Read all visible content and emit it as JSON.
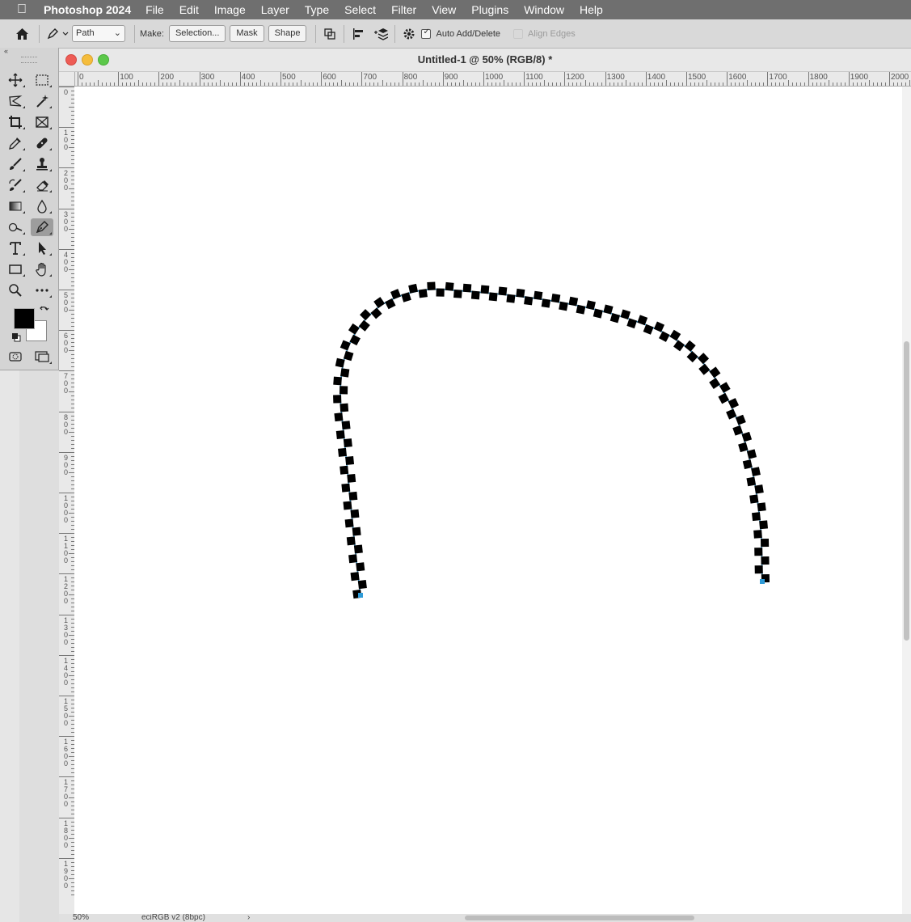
{
  "menubar": {
    "app_name": "Photoshop 2024",
    "items": [
      "File",
      "Edit",
      "Image",
      "Layer",
      "Type",
      "Select",
      "Filter",
      "View",
      "Plugins",
      "Window",
      "Help"
    ]
  },
  "options_bar": {
    "mode_value": "Path",
    "make_label": "Make:",
    "selection_button": "Selection...",
    "mask_button": "Mask",
    "shape_button": "Shape",
    "auto_add_delete_label": "Auto Add/Delete",
    "auto_add_delete_checked": true,
    "align_edges_label": "Align Edges",
    "align_edges_enabled": false
  },
  "document": {
    "title": "Untitled-1 @ 50% (RGB/8) *",
    "zoom": "50%",
    "color_profile": "eciRGB v2 (8bpc)"
  },
  "rulers": {
    "horizontal_labels": [
      "0",
      "100",
      "200",
      "300",
      "400",
      "500",
      "600",
      "700",
      "800",
      "900",
      "1000",
      "1100",
      "1200",
      "1300",
      "1400",
      "1500",
      "1600",
      "1700",
      "1800",
      "1900",
      "2000"
    ],
    "vertical_labels": [
      "0",
      "100",
      "200",
      "300",
      "400",
      "500",
      "600",
      "700",
      "800",
      "900",
      "1000",
      "1100",
      "1200",
      "1300",
      "1400",
      "1500",
      "1600",
      "1700",
      "1800",
      "1900"
    ]
  },
  "colors": {
    "foreground": "#000000",
    "background": "#ffffff",
    "path_line": "#2f9bd7"
  },
  "tools": [
    "move-tool",
    "marquee-tool",
    "lasso-tool",
    "magic-wand-tool",
    "crop-tool",
    "frame-tool",
    "eyedropper-tool",
    "healing-brush-tool",
    "brush-tool",
    "clone-stamp-tool",
    "history-brush-tool",
    "eraser-tool",
    "gradient-tool",
    "blur-tool",
    "dodge-tool",
    "pen-tool",
    "type-tool",
    "path-selection-tool",
    "rectangle-tool",
    "hand-tool",
    "zoom-tool",
    "more-tools"
  ],
  "active_tool": "pen-tool"
}
